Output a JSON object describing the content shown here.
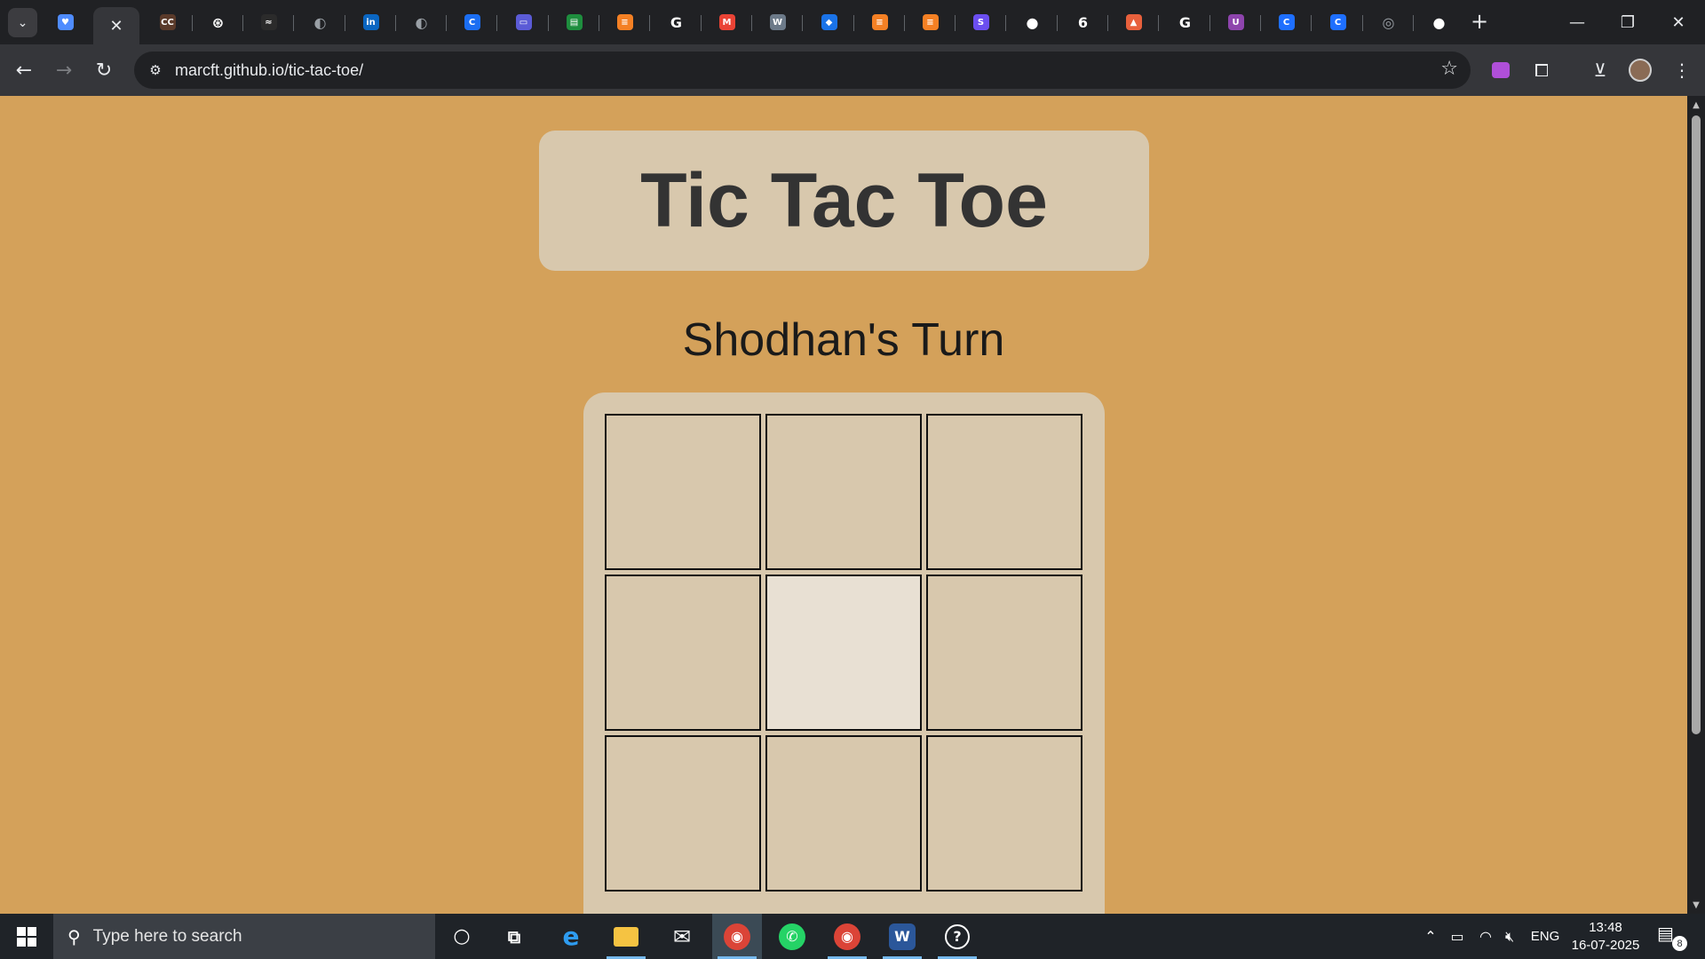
{
  "browser": {
    "active_tab_close_glyph": "✕",
    "tabs": [
      {
        "icon": "bookmark-heart-icon",
        "color": "#4f8cff",
        "glyph": "♥"
      },
      {
        "icon": "close-icon",
        "active": true
      },
      {
        "icon": "cc-icon",
        "color": "#5a3a2a",
        "glyph": "CC"
      },
      {
        "icon": "openai-icon",
        "color": "#ffffff",
        "glyph": "⊛"
      },
      {
        "icon": "site-icon",
        "color": "#2b2b2b",
        "glyph": "≈"
      },
      {
        "icon": "globe-icon",
        "color": "#9aa0a6",
        "glyph": "◐"
      },
      {
        "icon": "linkedin-icon",
        "color": "#0a66c2",
        "glyph": "in"
      },
      {
        "icon": "globe-icon",
        "color": "#9aa0a6",
        "glyph": "◐"
      },
      {
        "icon": "copilot-icon",
        "color": "#1b6ef3",
        "glyph": "C"
      },
      {
        "icon": "chat-icon",
        "color": "#5b5bd6",
        "glyph": "▭"
      },
      {
        "icon": "sheets-icon",
        "color": "#1e8e3e",
        "glyph": "▤"
      },
      {
        "icon": "stack-icon",
        "color": "#f48024",
        "glyph": "≡"
      },
      {
        "icon": "google-icon",
        "color": "#ffffff",
        "glyph": "G"
      },
      {
        "icon": "gmail-icon",
        "color": "#ea4335",
        "glyph": "M"
      },
      {
        "icon": "wiki-icon",
        "color": "#6c7a89",
        "glyph": "W"
      },
      {
        "icon": "bookmark-icon",
        "color": "#1a73e8",
        "glyph": "◆"
      },
      {
        "icon": "stack-icon",
        "color": "#f48024",
        "glyph": "≡"
      },
      {
        "icon": "stack-icon",
        "color": "#f48024",
        "glyph": "≡"
      },
      {
        "icon": "grammarly-icon",
        "color": "#6b4ef0",
        "glyph": "S"
      },
      {
        "icon": "github-icon",
        "color": "#ffffff",
        "glyph": "●"
      },
      {
        "icon": "six-icon",
        "color": "#ffffff",
        "glyph": "6"
      },
      {
        "icon": "fire-icon",
        "color": "#e8603c",
        "glyph": "▲"
      },
      {
        "icon": "google-icon",
        "color": "#ffffff",
        "glyph": "G"
      },
      {
        "icon": "u-icon",
        "color": "#8e44ad",
        "glyph": "U"
      },
      {
        "icon": "c-icon",
        "color": "#1e6fff",
        "glyph": "C"
      },
      {
        "icon": "c-icon",
        "color": "#1e6fff",
        "glyph": "C"
      },
      {
        "icon": "chrome-icon",
        "color": "#9aa0a6",
        "glyph": "◎"
      },
      {
        "icon": "github-icon",
        "color": "#ffffff",
        "glyph": "●"
      }
    ],
    "new_tab_glyph": "+",
    "window_controls": {
      "minimize": "—",
      "restore": "❐",
      "close": "✕"
    },
    "url": "marcft.github.io/tic-tac-toe/",
    "nav": {
      "back": "←",
      "forward": "→",
      "reload": "↻"
    },
    "bookmark_star": "☆"
  },
  "game": {
    "title": "Tic Tac Toe",
    "status": "Shodhan's Turn",
    "cells": [
      "",
      "",
      "",
      "",
      "",
      "",
      "",
      "",
      ""
    ],
    "hovered_cell": 4,
    "colors": {
      "page_bg": "#d4a15a",
      "panel_bg": "#d8c8ad",
      "cell_hover": "#e8e0d3",
      "title_text": "#333333"
    }
  },
  "taskbar": {
    "search_placeholder": "Type here to search",
    "apps": [
      {
        "name": "cortana",
        "glyph": "○"
      },
      {
        "name": "task-view",
        "glyph": "⧉"
      },
      {
        "name": "edge",
        "glyph": "e"
      },
      {
        "name": "file-explorer",
        "glyph": "▬"
      },
      {
        "name": "mail",
        "glyph": "✉"
      },
      {
        "name": "chrome",
        "glyph": "◉"
      },
      {
        "name": "whatsapp",
        "glyph": "✆"
      },
      {
        "name": "chrome-profile",
        "glyph": "◉"
      },
      {
        "name": "word",
        "glyph": "W"
      },
      {
        "name": "feedback",
        "glyph": "?"
      }
    ],
    "language": "ENG",
    "time": "13:48",
    "date": "16-07-2025",
    "notification_count": "8"
  }
}
